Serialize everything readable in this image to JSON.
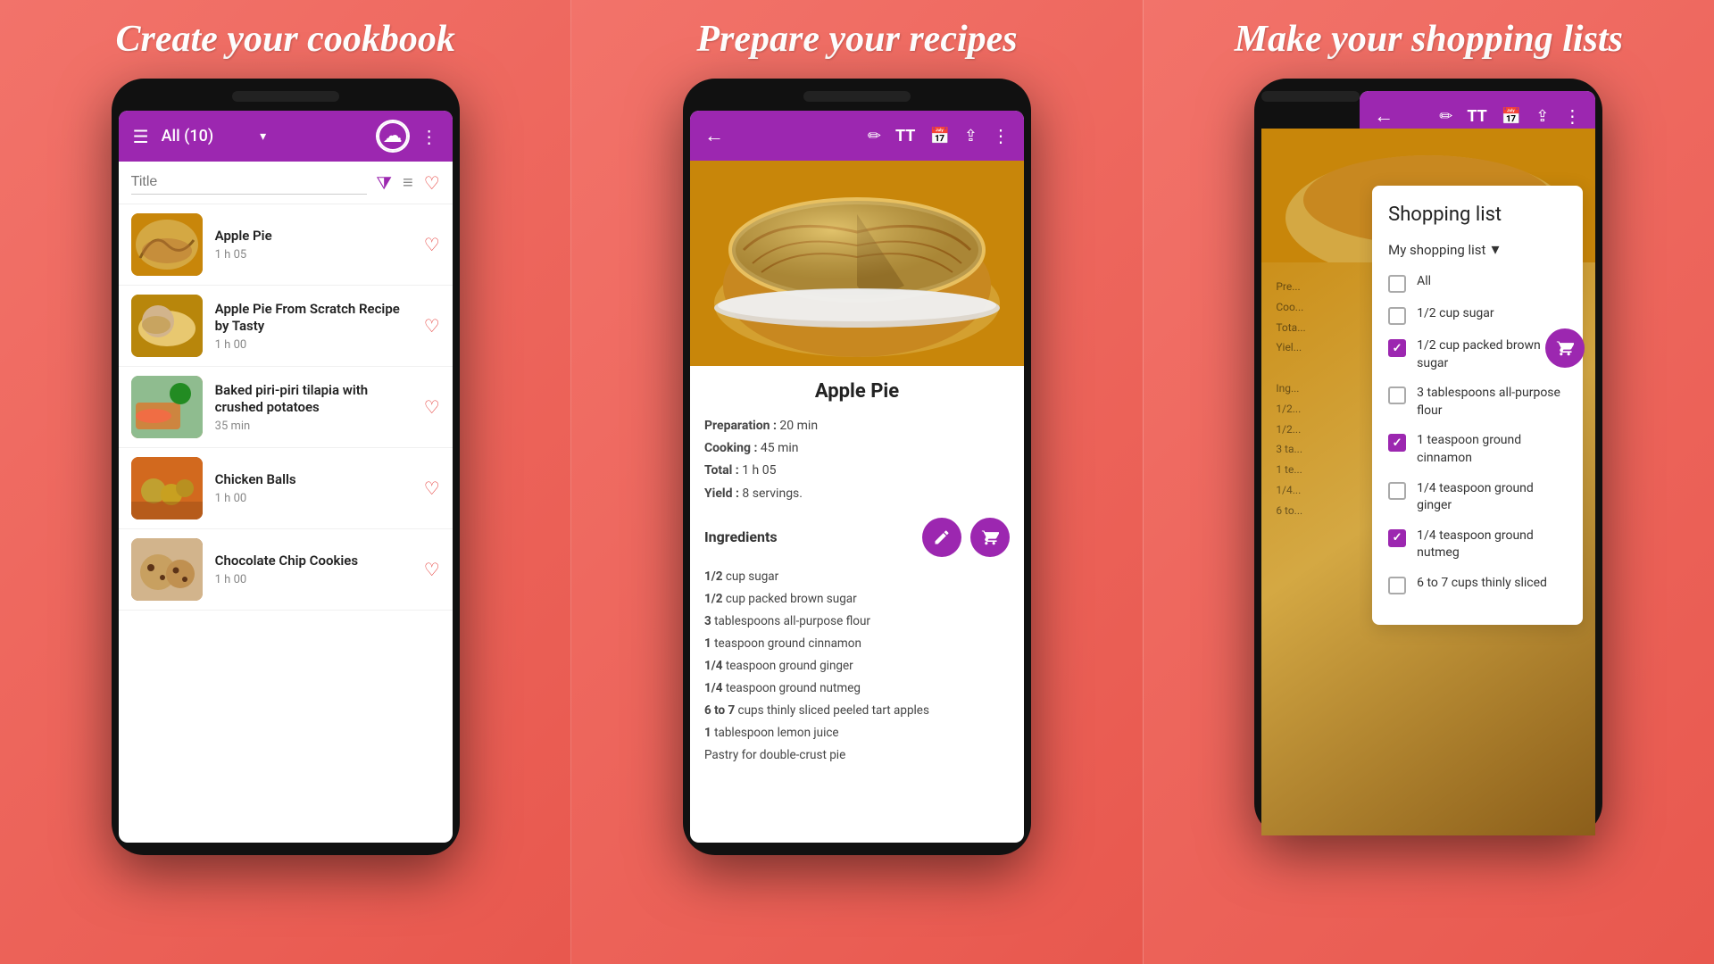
{
  "panel1": {
    "title": "Create your cookbook",
    "toolbar": {
      "menu_label": "☰",
      "list_name": "All (10)",
      "dropdown": "▾",
      "cloud_icon": "☁",
      "more_icon": "⋮"
    },
    "search": {
      "placeholder": "Title"
    },
    "recipes": [
      {
        "name": "Apple Pie",
        "time": "1 h 05",
        "thumb_class": "thumb-apple-pie"
      },
      {
        "name": "Apple Pie From Scratch Recipe by Tasty",
        "time": "1 h 00",
        "thumb_class": "thumb-apple-pie-from-scratch"
      },
      {
        "name": "Baked piri-piri tilapia with crushed potatoes",
        "time": "35 min",
        "thumb_class": "thumb-tilapia"
      },
      {
        "name": "Chicken Balls",
        "time": "1 h 00",
        "thumb_class": "thumb-chicken"
      },
      {
        "name": "Chocolate Chip Cookies",
        "time": "1 h 00",
        "thumb_class": "thumb-cookies"
      }
    ]
  },
  "panel2": {
    "title": "Prepare your recipes",
    "toolbar_icons": [
      "←",
      "✏",
      "TT",
      "📅",
      "⇪",
      "⋮"
    ],
    "recipe": {
      "name": "Apple Pie",
      "preparation": "20 min",
      "cooking": "45 min",
      "total": "1 h 05",
      "yield": "8 servings.",
      "ingredients_title": "Ingredients",
      "ingredients": [
        {
          "qty": "1/2",
          "rest": "cup sugar"
        },
        {
          "qty": "1/2",
          "rest": "cup packed brown sugar"
        },
        {
          "qty": "3",
          "rest": "tablespoons all-purpose flour"
        },
        {
          "qty": "1",
          "rest": "teaspoon ground cinnamon"
        },
        {
          "qty": "1/4",
          "rest": "teaspoon ground ginger"
        },
        {
          "qty": "1/4",
          "rest": "teaspoon ground nutmeg"
        },
        {
          "qty": "6 to 7",
          "rest": "cups thinly sliced peeled tart apples"
        },
        {
          "qty": "1",
          "rest": "tablespoon lemon juice"
        },
        {
          "qty": "",
          "rest": "Pastry for double-crust pie"
        }
      ]
    }
  },
  "panel3": {
    "title": "Make your shopping lists",
    "shopping": {
      "header": "Shopping list",
      "list_name": "My shopping list",
      "items": [
        {
          "label": "All",
          "checked": false
        },
        {
          "label": "1/2 cup sugar",
          "checked": false
        },
        {
          "label": "1/2 cup packed brown sugar",
          "checked": true
        },
        {
          "label": "3 tablespoons all-purpose flour",
          "checked": false
        },
        {
          "label": "1 teaspoon ground cinnamon",
          "checked": true
        },
        {
          "label": "1/4 teaspoon ground ginger",
          "checked": false
        },
        {
          "label": "1/4 teaspoon ground nutmeg",
          "checked": true
        },
        {
          "label": "6 to 7 cups thinly sliced",
          "checked": false
        }
      ]
    },
    "behind_text": "Pre...\nCoo...\nTota...\nYiel...\n\nIng...\n1/2...\n1/2...\n3 ta...\n1 te...\n1/4...\n6 to..."
  }
}
